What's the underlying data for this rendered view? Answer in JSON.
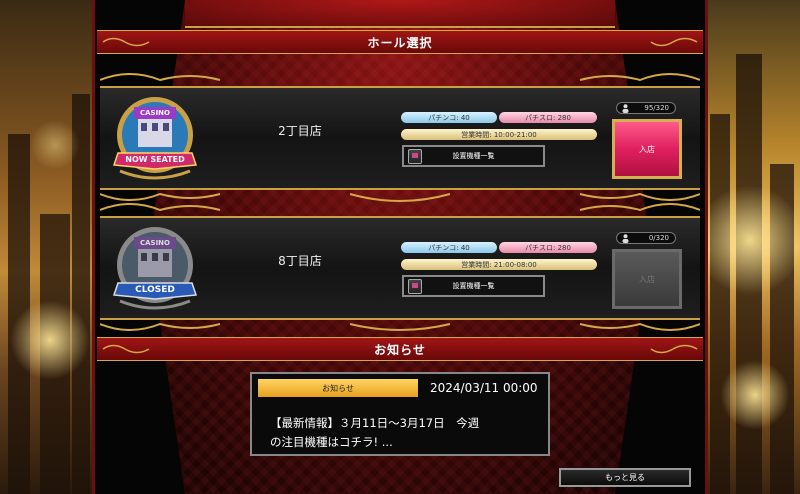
{
  "header": {
    "title": "ホール選択"
  },
  "halls": [
    {
      "badge": "NOW SEATED",
      "name": "2丁目店",
      "pachinko": "パチンコ: 40",
      "pachislot": "パチスロ: 280",
      "hours": "営業時間: 10:00-21:00",
      "machines": "設置機種一覧",
      "occupancy": "95/320",
      "enter": "入店",
      "status": "open"
    },
    {
      "badge": "CLOSED",
      "name": "8丁目店",
      "pachinko": "パチンコ: 40",
      "pachislot": "パチスロ: 280",
      "hours": "営業時間: 21:00-08:00",
      "machines": "設置機種一覧",
      "occupancy": "0/320",
      "enter": "入店",
      "status": "closed"
    }
  ],
  "news": {
    "header": "お知らせ",
    "tag": "お知らせ",
    "date": "2024/03/11 00:00",
    "line1": "【最新情報】３月11日～3月17日　今週",
    "line2": "の注目機種はコチラ! ...",
    "more": "もっと見る"
  },
  "badge_casino_text": "CASINO",
  "colors": {
    "gold": "#c9a046",
    "crimson": "#a01616",
    "enter_pink": "#e02060"
  }
}
